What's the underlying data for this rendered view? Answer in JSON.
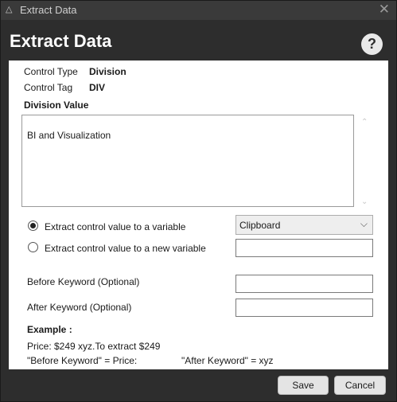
{
  "window": {
    "title": "Extract Data"
  },
  "header": {
    "heading": "Extract Data",
    "help_label": "?"
  },
  "control": {
    "type_label": "Control Type",
    "type_value": "Division",
    "tag_label": "Control Tag",
    "tag_value": "DIV"
  },
  "division": {
    "label": "Division Value",
    "value": "BI and Visualization"
  },
  "options": {
    "radio_existing": "Extract control value to a variable",
    "radio_new": "Extract control value to a new variable",
    "selected_variable": "Clipboard",
    "new_variable_value": ""
  },
  "keywords": {
    "before_label": "Before Keyword (Optional)",
    "after_label": "After Keyword (Optional)",
    "before_value": "",
    "after_value": ""
  },
  "example": {
    "heading": "Example :",
    "line1": "Price: $249 xyz.To extract $249",
    "before": "\"Before Keyword\" = Price:",
    "after": "\"After Keyword\" = xyz"
  },
  "footer": {
    "save": "Save",
    "cancel": "Cancel"
  },
  "icons": {
    "app": "app-icon",
    "close": "close-icon",
    "help": "help-icon"
  }
}
